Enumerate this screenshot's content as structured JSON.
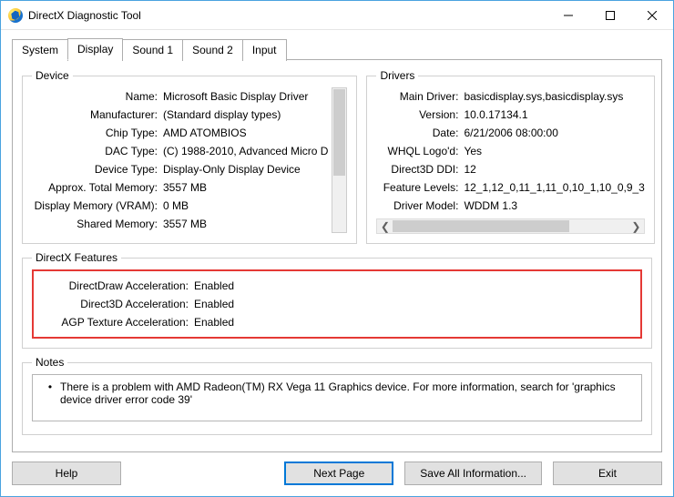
{
  "window": {
    "title": "DirectX Diagnostic Tool"
  },
  "tabs": [
    {
      "label": "System"
    },
    {
      "label": "Display"
    },
    {
      "label": "Sound 1"
    },
    {
      "label": "Sound 2"
    },
    {
      "label": "Input"
    }
  ],
  "active_tab_index": 1,
  "groups": {
    "device_title": "Device",
    "drivers_title": "Drivers",
    "dx_features_title": "DirectX Features",
    "notes_title": "Notes"
  },
  "device": [
    {
      "k": "Name:",
      "v": "Microsoft Basic Display Driver"
    },
    {
      "k": "Manufacturer:",
      "v": "(Standard display types)"
    },
    {
      "k": "Chip Type:",
      "v": "AMD ATOMBIOS"
    },
    {
      "k": "DAC Type:",
      "v": "(C) 1988-2010, Advanced Micro D"
    },
    {
      "k": "Device Type:",
      "v": "Display-Only Display Device"
    },
    {
      "k": "Approx. Total Memory:",
      "v": "3557 MB"
    },
    {
      "k": "Display Memory (VRAM):",
      "v": "0 MB"
    },
    {
      "k": "Shared Memory:",
      "v": "3557 MB"
    }
  ],
  "drivers": [
    {
      "k": "Main Driver:",
      "v": "basicdisplay.sys,basicdisplay.sys"
    },
    {
      "k": "Version:",
      "v": "10.0.17134.1"
    },
    {
      "k": "Date:",
      "v": "6/21/2006 08:00:00"
    },
    {
      "k": "WHQL Logo'd:",
      "v": "Yes"
    },
    {
      "k": "Direct3D DDI:",
      "v": "12"
    },
    {
      "k": "Feature Levels:",
      "v": "12_1,12_0,11_1,11_0,10_1,10_0,9_3"
    },
    {
      "k": "Driver Model:",
      "v": "WDDM 1.3"
    }
  ],
  "dx_features": [
    {
      "k": "DirectDraw Acceleration:",
      "v": "Enabled"
    },
    {
      "k": "Direct3D Acceleration:",
      "v": "Enabled"
    },
    {
      "k": "AGP Texture Acceleration:",
      "v": "Enabled"
    }
  ],
  "notes": {
    "text": "There is a problem with AMD Radeon(TM) RX Vega 11 Graphics device. For more information, search for 'graphics device driver error code 39'"
  },
  "buttons": {
    "help": "Help",
    "next_page": "Next Page",
    "save_all": "Save All Information...",
    "exit": "Exit"
  }
}
